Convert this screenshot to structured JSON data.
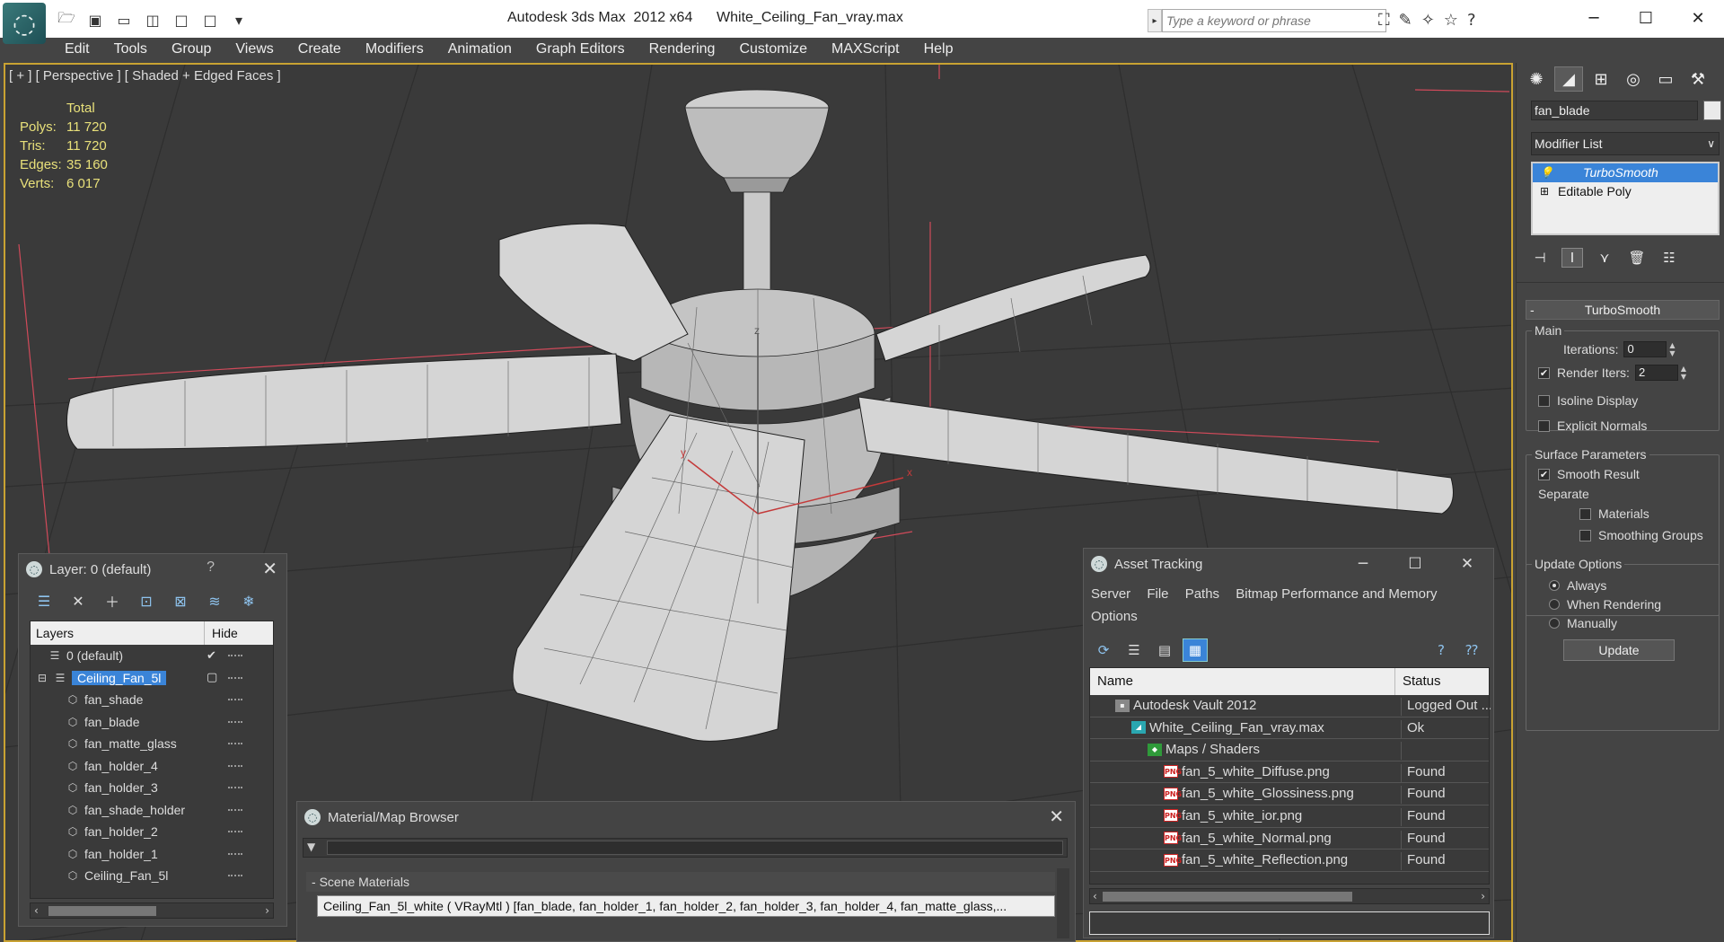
{
  "app": {
    "title": "Autodesk 3ds Max  2012 x64      White_Ceiling_Fan_vray.max",
    "logo_glyph": "◌"
  },
  "search": {
    "placeholder": "Type a keyword or phrase"
  },
  "window_controls": {
    "minimize": "─",
    "maximize": "☐",
    "close": "✕"
  },
  "menu": [
    "Edit",
    "Tools",
    "Group",
    "Views",
    "Create",
    "Modifiers",
    "Animation",
    "Graph Editors",
    "Rendering",
    "Customize",
    "MAXScript",
    "Help"
  ],
  "viewport": {
    "label": "[ + ] [ Perspective ] [ Shaded + Edged Faces ]",
    "stats": {
      "header": "Total",
      "rows": [
        {
          "k": "Polys:",
          "v": "11 720"
        },
        {
          "k": "Tris:",
          "v": "11 720"
        },
        {
          "k": "Edges:",
          "v": "35 160"
        },
        {
          "k": "Verts:",
          "v": "6 017"
        }
      ]
    },
    "axis_labels": {
      "z": "z",
      "x": "x",
      "y": "y"
    },
    "accent_border": "#c9a232"
  },
  "command_panel": {
    "object_name": "fan_blade",
    "modifier_list_label": "Modifier List",
    "stack": [
      "TurboSmooth",
      "Editable Poly"
    ],
    "rollout_title": "TurboSmooth",
    "main_group": "Main",
    "iterations_label": "Iterations:",
    "iterations_value": "0",
    "render_iters_label": "Render Iters:",
    "render_iters_value": "2",
    "isoline_label": "Isoline Display",
    "explicit_normals_label": "Explicit Normals",
    "surface_group": "Surface Parameters",
    "smooth_result_label": "Smooth Result",
    "separate_label": "Separate",
    "materials_label": "Materials",
    "smoothing_groups_label": "Smoothing Groups",
    "update_group": "Update Options",
    "always_label": "Always",
    "when_rendering_label": "When Rendering",
    "manually_label": "Manually",
    "update_button": "Update"
  },
  "layer_window": {
    "title": "Layer: 0 (default)",
    "help": "?",
    "col_layers": "Layers",
    "col_hide": "Hide",
    "rows": [
      {
        "name": "0 (default)",
        "indent": 1
      },
      {
        "name": "Ceiling_Fan_5l",
        "indent": 1
      },
      {
        "name": "fan_shade",
        "indent": 2
      },
      {
        "name": "fan_blade",
        "indent": 2
      },
      {
        "name": "fan_matte_glass",
        "indent": 2
      },
      {
        "name": "fan_holder_4",
        "indent": 2
      },
      {
        "name": "fan_holder_3",
        "indent": 2
      },
      {
        "name": "fan_shade_holder",
        "indent": 2
      },
      {
        "name": "fan_holder_2",
        "indent": 2
      },
      {
        "name": "fan_holder_1",
        "indent": 2
      },
      {
        "name": "Ceiling_Fan_5l",
        "indent": 2
      }
    ]
  },
  "material_browser": {
    "title": "Material/Map Browser",
    "section": "Scene Materials",
    "entry": "Ceiling_Fan_5l_white  ( VRayMtl ) [fan_blade, fan_holder_1, fan_holder_2, fan_holder_3, fan_holder_4, fan_matte_glass,..."
  },
  "asset_tracking": {
    "title": "Asset Tracking",
    "menu": [
      "Server",
      "File",
      "Paths",
      "Bitmap Performance and Memory",
      "Options"
    ],
    "col_name": "Name",
    "col_status": "Status",
    "rows": [
      {
        "name": "Autodesk Vault 2012",
        "status": "Logged Out ...",
        "icon": "vault",
        "indent": 1
      },
      {
        "name": "White_Ceiling_Fan_vray.max",
        "status": "Ok",
        "icon": "max",
        "indent": 2
      },
      {
        "name": "Maps / Shaders",
        "status": "",
        "icon": "maps",
        "indent": 3
      },
      {
        "name": "fan_5_white_Diffuse.png",
        "status": "Found",
        "icon": "png",
        "indent": 4
      },
      {
        "name": "fan_5_white_Glossiness.png",
        "status": "Found",
        "icon": "png",
        "indent": 4
      },
      {
        "name": "fan_5_white_ior.png",
        "status": "Found",
        "icon": "png",
        "indent": 4
      },
      {
        "name": "fan_5_white_Normal.png",
        "status": "Found",
        "icon": "png",
        "indent": 4
      },
      {
        "name": "fan_5_white_Reflection.png",
        "status": "Found",
        "icon": "png",
        "indent": 4
      }
    ]
  }
}
